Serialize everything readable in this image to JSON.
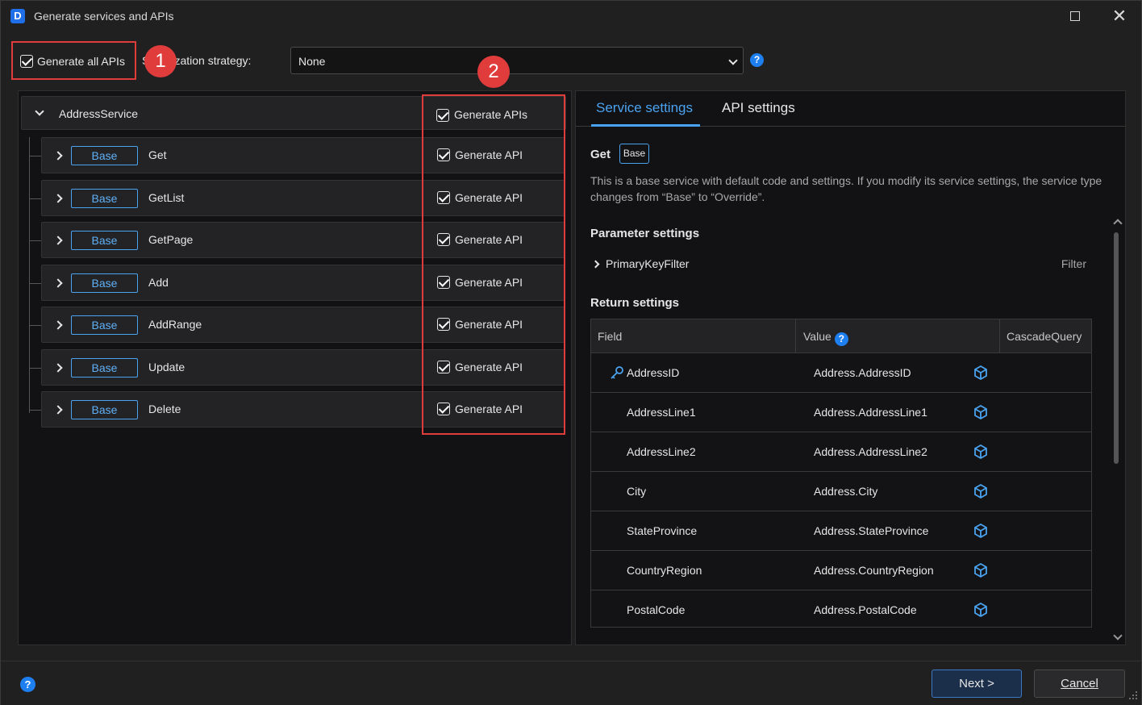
{
  "window": {
    "title": "Generate services and APIs",
    "app_icon_letter": "D"
  },
  "top": {
    "generate_all_label": "Generate all APIs",
    "generate_all_checked": true,
    "authorization_label": "S thorization strategy:",
    "authorization_value": "None",
    "annotation_1": "1",
    "annotation_2": "2"
  },
  "left": {
    "service_name": "AddressService",
    "generate_apis_label": "Generate APIs",
    "generate_apis_checked": true,
    "apis": [
      {
        "tag": "Base",
        "name": "Get",
        "generate_label": "Generate API",
        "checked": true
      },
      {
        "tag": "Base",
        "name": "GetList",
        "generate_label": "Generate API",
        "checked": true
      },
      {
        "tag": "Base",
        "name": "GetPage",
        "generate_label": "Generate API",
        "checked": true
      },
      {
        "tag": "Base",
        "name": "Add",
        "generate_label": "Generate API",
        "checked": true
      },
      {
        "tag": "Base",
        "name": "AddRange",
        "generate_label": "Generate API",
        "checked": true
      },
      {
        "tag": "Base",
        "name": "Update",
        "generate_label": "Generate API",
        "checked": true
      },
      {
        "tag": "Base",
        "name": "Delete",
        "generate_label": "Generate API",
        "checked": true
      }
    ]
  },
  "right": {
    "tabs": [
      "Service settings",
      "API settings"
    ],
    "active_tab": "Service settings",
    "api_title": "Get",
    "api_tag": "Base",
    "description": "This is a base service with default code and settings. If you modify its service settings, the service type changes from “Base” to “Override”.",
    "parameter_heading": "Parameter settings",
    "parameter": {
      "name": "PrimaryKeyFilter",
      "type": "Filter"
    },
    "return_heading": "Return settings",
    "columns": {
      "field": "Field",
      "value": "Value",
      "cascade": "CascadeQuery"
    },
    "rows": [
      {
        "field": "AddressID",
        "value": "Address.AddressID",
        "is_key": true
      },
      {
        "field": "AddressLine1",
        "value": "Address.AddressLine1",
        "is_key": false
      },
      {
        "field": "AddressLine2",
        "value": "Address.AddressLine2",
        "is_key": false
      },
      {
        "field": "City",
        "value": "Address.City",
        "is_key": false
      },
      {
        "field": "StateProvince",
        "value": "Address.StateProvince",
        "is_key": false
      },
      {
        "field": "CountryRegion",
        "value": "Address.CountryRegion",
        "is_key": false
      },
      {
        "field": "PostalCode",
        "value": "Address.PostalCode",
        "is_key": false
      }
    ]
  },
  "footer": {
    "next_label": "Next >",
    "cancel_label": "Cancel"
  },
  "colors": {
    "accent": "#4aa3f0",
    "annotation_red": "#e03c3c",
    "help_blue": "#1e7ff0",
    "background": "#202020",
    "panel": "#121214"
  },
  "icons": {
    "help": "question-circle-icon",
    "key": "key-icon",
    "cube": "cube-icon"
  }
}
